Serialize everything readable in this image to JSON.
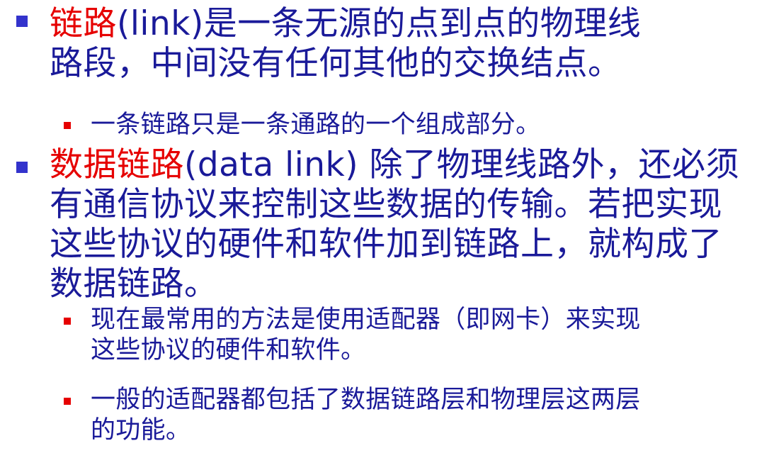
{
  "bullets": [
    {
      "level": 1,
      "highlight": "链路",
      "line1": "(link)是一条无源的点到点的物理线",
      "line2": "路段，中间没有任何其他的交换结点。"
    },
    {
      "level": 2,
      "line1": "一条链路只是一条通路的一个组成部分。"
    },
    {
      "level": 1,
      "highlight": "数据链路",
      "line1": "(data link) 除了物理线路外，还必须",
      "line2": "有通信协议来控制这些数据的传输。若把实现",
      "line3": "这些协议的硬件和软件加到链路上，就构成了",
      "line4": "数据链路。"
    },
    {
      "level": 2,
      "line1": "现在最常用的方法是使用适配器（即网卡）来实现",
      "line2": "这些协议的硬件和软件。"
    },
    {
      "level": 2,
      "line1": "一般的适配器都包括了数据链路层和物理层这两层",
      "line2": "的功能。"
    }
  ],
  "colors": {
    "text": "#1a1a99",
    "highlight": "#e60000",
    "bullet_level1": "#3333cc",
    "bullet_level2": "#e60000"
  }
}
